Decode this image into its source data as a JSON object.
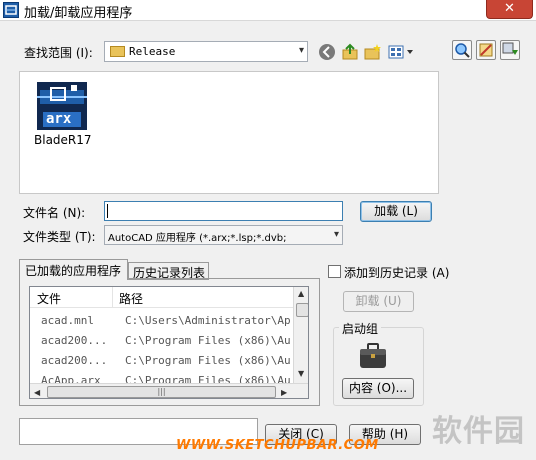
{
  "window": {
    "title": "加载/卸载应用程序",
    "close_glyph": "✕"
  },
  "lookin": {
    "label": "查找范围 (I):",
    "value": "Release",
    "arrow": "▾"
  },
  "file_items": [
    {
      "name": "BladeR17",
      "icon_text": "arx"
    }
  ],
  "filename": {
    "label": "文件名 (N):",
    "value": ""
  },
  "filetype": {
    "label": "文件类型 (T):",
    "value": "AutoCAD 应用程序 (*.arx;*.lsp;*.dvb;",
    "arrow": "▾"
  },
  "load_button": "加载 (L)",
  "tabs": [
    {
      "label": "已加载的应用程序",
      "active": true
    },
    {
      "label": "历史记录列表",
      "active": false
    }
  ],
  "loaded_apps": {
    "columns": [
      "文件",
      "路径"
    ],
    "rows": [
      {
        "file": "acad.mnl",
        "path": "C:\\Users\\Administrator\\Ap..."
      },
      {
        "file": "acad200...",
        "path": "C:\\Program Files (x86)\\Au..."
      },
      {
        "file": "acad200...",
        "path": "C:\\Program Files (x86)\\Au..."
      },
      {
        "file": "AcApp.arx",
        "path": "C:\\Program Files (x86)\\Au..."
      }
    ],
    "scroll_glyphs": {
      "up": "▲",
      "down": "▼",
      "left": "◀",
      "right": "▶",
      "grip": "|||"
    }
  },
  "add_to_history": {
    "label": "添加到历史记录 (A)",
    "checked": false
  },
  "unload_button": "卸载 (U)",
  "startup_group": {
    "label": "启动组",
    "contents_button": "内容 (O)..."
  },
  "close_button": "关闭 (C)",
  "help_button": "帮助 (H)",
  "watermark": {
    "url": "WWW.SKETCHUPBAR.COM",
    "site": "软件园"
  },
  "colors": {
    "title_close": "#c84535",
    "arx_icon": "#1f5ea8",
    "watermark_orange": "#ff7a00",
    "default_button_border": "#3c7fb1"
  },
  "icons": [
    "app-icon",
    "back-icon",
    "up-folder-icon",
    "new-folder-icon",
    "views-icon",
    "search-web-icon",
    "tools-icon",
    "options-icon",
    "briefcase-icon"
  ]
}
